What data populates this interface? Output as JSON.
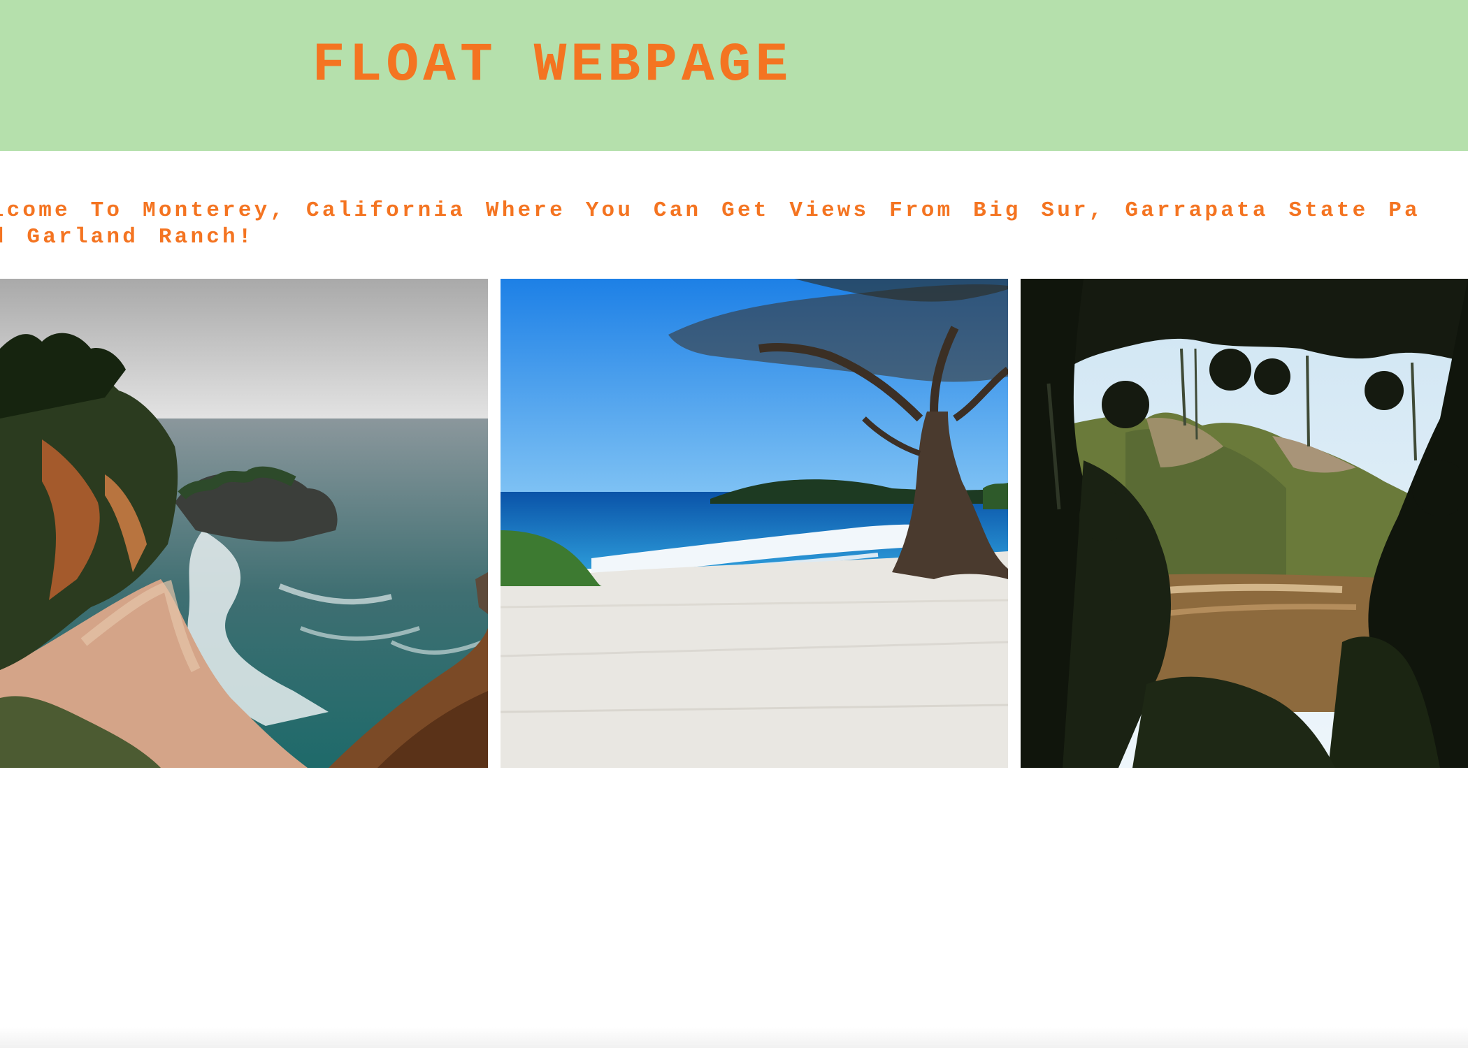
{
  "header": {
    "title": "FLOAT WEBPAGE",
    "background_color": "#b5e0ac",
    "text_color": "#f47421"
  },
  "intro": {
    "line1": "elcome To Monterey, California Where You Can Get Views From Big Sur, Garrapata State Pa",
    "line2": "nd Garland Ranch!"
  },
  "gallery": {
    "images": [
      {
        "subject": "Rocky coastal cove with beach and cliffs under cloudy sky"
      },
      {
        "subject": "White sand beach with cypress tree and blue ocean"
      },
      {
        "subject": "Green mountain valley framed by dark tree silhouettes"
      }
    ]
  }
}
